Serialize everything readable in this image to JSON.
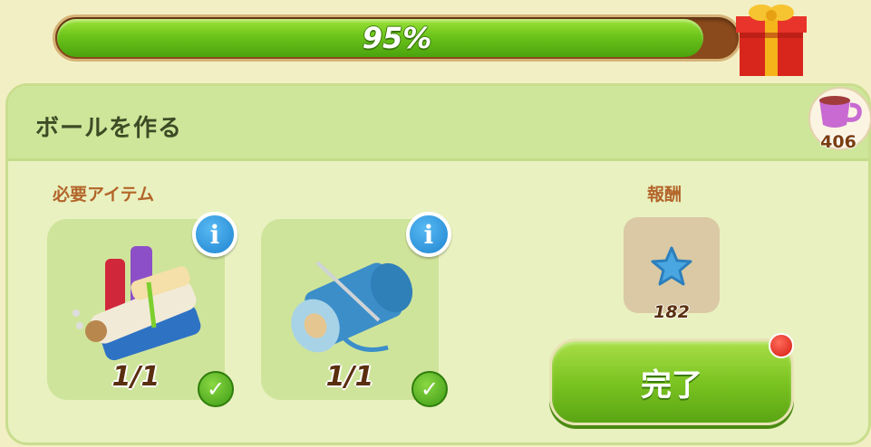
{
  "progress": {
    "percent_label": "95%",
    "value": 0.95
  },
  "quest": {
    "title": "ボールを作る"
  },
  "currency": {
    "count": "406",
    "icon": "tea-cup-icon"
  },
  "required": {
    "label": "必要アイテム",
    "items": [
      {
        "name": "fabric-rolls",
        "count": "1/1"
      },
      {
        "name": "thread-spool",
        "count": "1/1"
      }
    ]
  },
  "reward": {
    "label": "報酬",
    "count": "182",
    "icon": "blue-star-icon"
  },
  "actions": {
    "complete_label": "完了"
  },
  "colors": {
    "accent_green": "#7cc421",
    "panel": "#e9f1c0",
    "header": "#cde69a",
    "label_orange": "#b3652a"
  }
}
